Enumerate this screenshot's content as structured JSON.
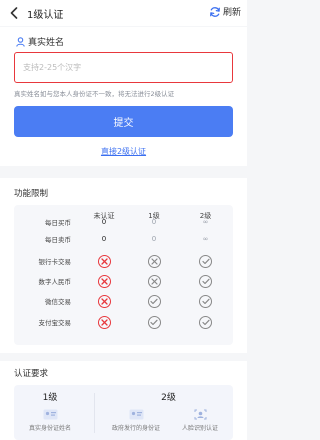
{
  "header": {
    "title": "1级认证",
    "refresh_label": "刷新"
  },
  "form": {
    "name_label": "真实姓名",
    "name_placeholder": "支持2-25个汉字",
    "hint": "真实姓名如与您本人身份证不一致，将无法进行2级认证",
    "submit_label": "提交",
    "link_label": "直接2级认证"
  },
  "limits": {
    "title": "功能限制",
    "headers": [
      "",
      "未认证",
      "1级",
      "2级"
    ],
    "rows": [
      {
        "name": "每日买币",
        "cells": [
          "0",
          "0",
          "∞"
        ]
      },
      {
        "name": "每日卖币",
        "cells": [
          "0",
          "0",
          "∞"
        ]
      },
      {
        "name": "银行卡交易",
        "cells": [
          "x-red",
          "x-gray",
          "check-gray"
        ]
      },
      {
        "name": "数字人民币",
        "cells": [
          "x-red",
          "x-gray",
          "check-gray"
        ]
      },
      {
        "name": "微信交易",
        "cells": [
          "x-red",
          "check-gray",
          "check-gray"
        ]
      },
      {
        "name": "支付宝交易",
        "cells": [
          "x-red",
          "check-gray",
          "check-gray"
        ]
      }
    ]
  },
  "requirements": {
    "title": "认证要求",
    "level1": {
      "label": "1级",
      "items": [
        {
          "icon": "id-card-icon",
          "text": "真实身份证姓名"
        }
      ]
    },
    "level2": {
      "label": "2级",
      "items": [
        {
          "icon": "id-document-icon",
          "text": "政府发行的身份证"
        },
        {
          "icon": "face-scan-icon",
          "text": "人脸识别认证"
        }
      ]
    }
  },
  "colors": {
    "accent": "#4b7df3",
    "error": "#e8383d",
    "link": "#3b6ff0"
  }
}
